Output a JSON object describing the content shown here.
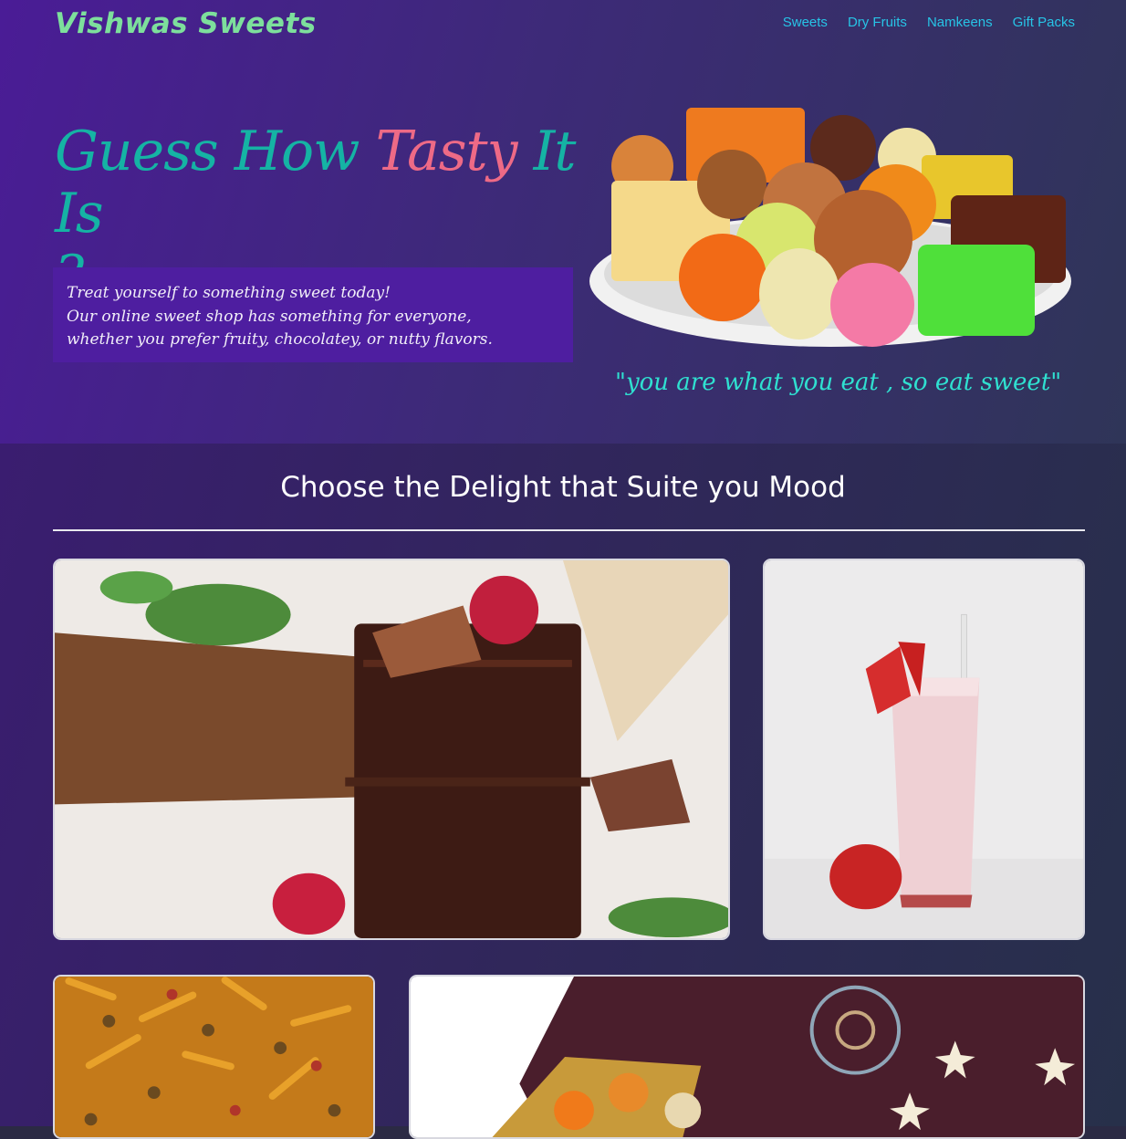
{
  "header": {
    "brand": "Vishwas Sweets",
    "nav": [
      "Sweets",
      "Dry Fruits",
      "Namkeens",
      "Gift Packs"
    ]
  },
  "hero": {
    "headline_a": "Guess How",
    "headline_b": "Tasty",
    "headline_c": "It Is",
    "headline_d": "?",
    "promo_lines": [
      "Treat yourself to something sweet today!",
      "Our online sweet shop has something for everyone,",
      "whether you prefer fruity, chocolatey, or nutty flavors."
    ],
    "quote": "\"you are what you eat , so eat sweet\""
  },
  "section": {
    "title": "Choose the Delight that Suite you Mood"
  },
  "colors": {
    "brand": "#7ddf9c",
    "nav": "#27c4e6",
    "headline": "#15b3a4",
    "headline_accent": "#ee6a86",
    "quote": "#2fe0d0",
    "promo_bg": "#4e1ea0"
  }
}
